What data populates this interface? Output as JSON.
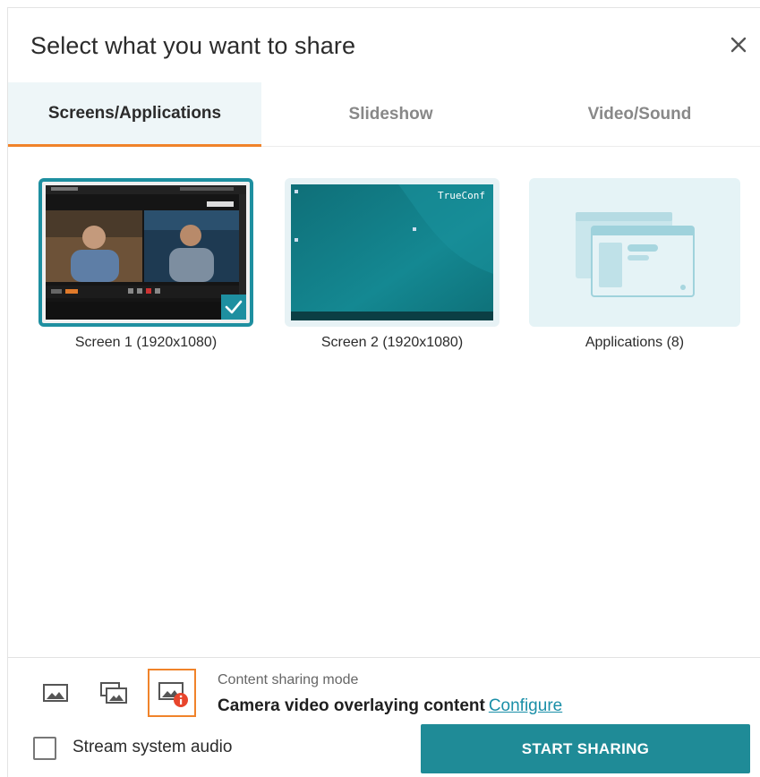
{
  "dialog": {
    "title": "Select what you want to share"
  },
  "tabs": [
    {
      "label": "Screens/Applications",
      "active": true
    },
    {
      "label": "Slideshow",
      "active": false
    },
    {
      "label": "Video/Sound",
      "active": false
    }
  ],
  "sources": [
    {
      "label": "Screen 1 (1920x1080)",
      "selected": true
    },
    {
      "label": "Screen 2 (1920x1080)",
      "selected": false,
      "brand": "TrueConf"
    },
    {
      "label": "Applications (8)",
      "selected": false
    }
  ],
  "mode": {
    "caption": "Content sharing mode",
    "value": "Camera video overlaying content",
    "configure_label": "Configure"
  },
  "audio": {
    "label": "Stream system audio",
    "checked": false
  },
  "actions": {
    "start_label": "START SHARING"
  },
  "colors": {
    "accent": "#1f8b97",
    "tab_underline": "#f0832a",
    "link": "#1a8fa8",
    "badge": "#e8452c"
  },
  "icons": [
    "close-icon",
    "content-only-icon",
    "content-and-video-icon",
    "camera-overlay-icon",
    "info-badge-icon",
    "check-icon",
    "application-windows-icon"
  ]
}
